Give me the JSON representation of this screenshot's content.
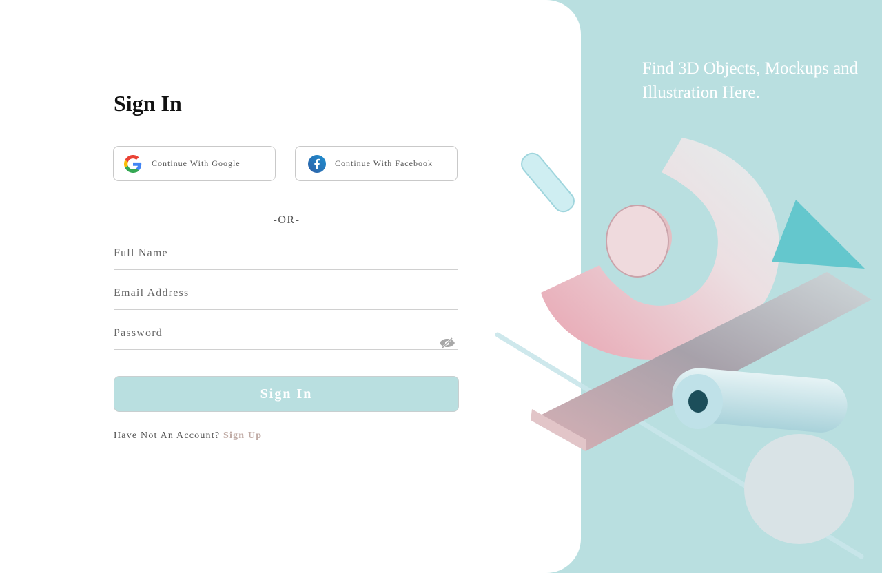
{
  "signin": {
    "title": "Sign In",
    "google_label": "Continue With Google",
    "facebook_label": "Continue With Facebook",
    "or_label": "-OR-",
    "full_name_placeholder": "Full Name",
    "email_placeholder": "Email Address",
    "password_placeholder": "Password",
    "submit_label": "Sign In",
    "no_account_text": "Have Not An Account?",
    "signup_link": "Sign Up"
  },
  "promo": {
    "tagline": "Find 3D Objects, Mockups and Illustration Here."
  },
  "colors": {
    "accent": "#b9dfe0",
    "link": "#c0aba5"
  }
}
